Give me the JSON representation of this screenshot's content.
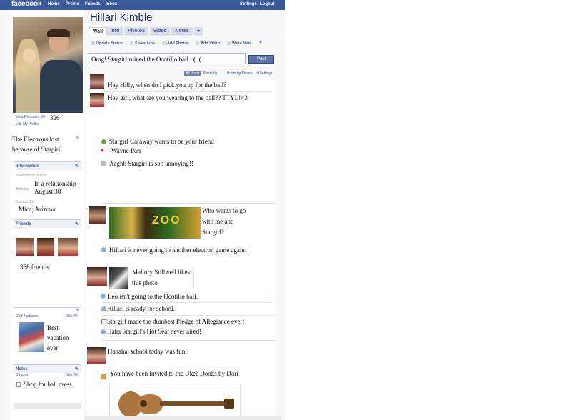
{
  "topbar": {
    "logo": "facebook",
    "nav": [
      "Home",
      "Profile",
      "Friends",
      "Inbox"
    ],
    "right_nav": [
      "Settings",
      "Logout"
    ]
  },
  "profile": {
    "name": "Hillari Kimble",
    "tabs": [
      "Wall",
      "Info",
      "Photos",
      "Video",
      "Notes",
      "+"
    ],
    "view_photos_label": "View Photos of Me",
    "view_photos_count": "326",
    "edit_profile_label": "Edit My Profile",
    "bio_text": "The Electrons lost because of Stargirl!",
    "information": {
      "header": "Information",
      "relationship_label": "Relationship Status",
      "relationship_value": "In a relationship",
      "birthday_label": "Birthday",
      "birthday_value": "August 38",
      "city_label": "Current City",
      "city_value": "Mica, Arizona"
    },
    "friends": {
      "header": "Friends",
      "count_text": "368 friends"
    },
    "albums": {
      "count_label": "2 of 4 albums",
      "see_all": "See All",
      "album_title": "Best vacation ever"
    },
    "notes": {
      "header": "Notes",
      "count_label": "2 notes",
      "see_all": "See All",
      "note_title": "Shop for ball dress."
    }
  },
  "publisher": {
    "actions": [
      "Update Status",
      "Share Link",
      "Add Photos",
      "Add Video",
      "Write Note"
    ],
    "status_value": "Omg! Stargirl ruined the Ocotillo ball. :( :(",
    "post_label": "Post",
    "filters": [
      "All Posts",
      "Posts by",
      "Posts by Others",
      "Settings"
    ]
  },
  "feed": {
    "post1": "Hey Hilly, when do I pick you up for the ball?",
    "post2": "Hey girl, what are you wearing to the ball?? TTYL!<3",
    "friend_request": "Stargirl Caraway wants to be your friend",
    "wayne": "-Wayne Parr",
    "annoying": "Aaghh Stargirl is soo annoying!!",
    "zoo_post": [
      "Who wants to go",
      "with me and",
      "Stargirl?"
    ],
    "zoo_banner": "ZOO",
    "never_game": "Hillari is never going to another electron game again!",
    "mallory": [
      "Mallory Stillwell likes",
      "this photo"
    ],
    "leo": "Leo isn't going to the Ocotillo ball.",
    "school_ready": "Hillari is ready for school.",
    "pledge": "Stargirl made the dumbest Pledge of Allegiance ever!",
    "hot_seat": "Haha Stargirl's Hot Seat never aired!",
    "school_fun": "Hahaha, school today was fun!",
    "invite": "You have been invited to the Ukee Dooks by Dori"
  }
}
